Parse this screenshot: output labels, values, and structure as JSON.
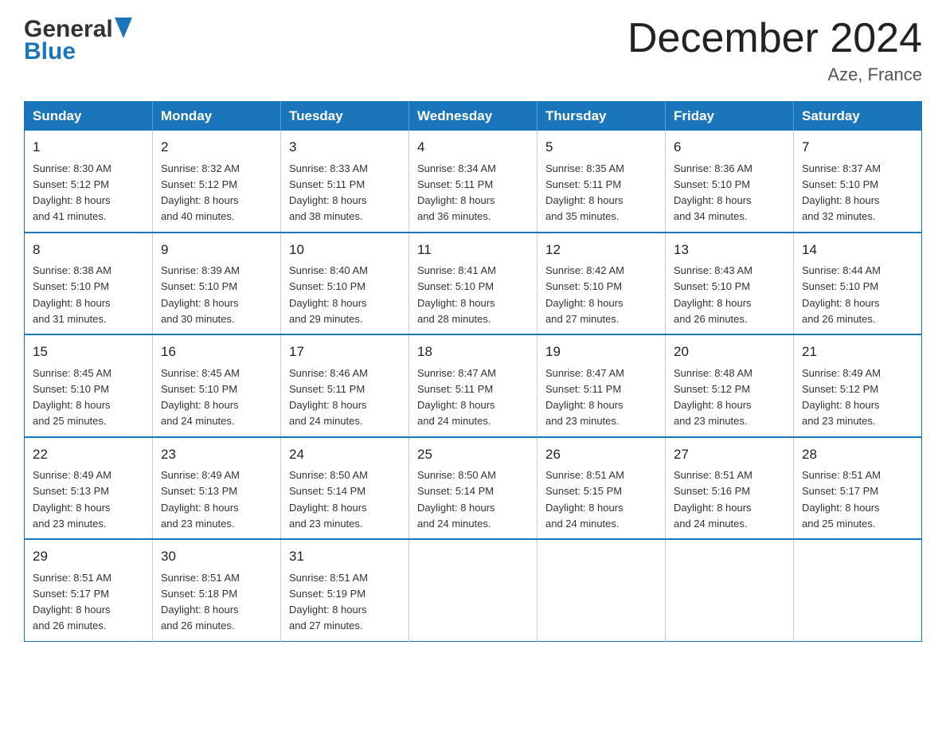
{
  "header": {
    "logo_general": "General",
    "logo_blue": "Blue",
    "title": "December 2024",
    "location": "Aze, France"
  },
  "days_of_week": [
    "Sunday",
    "Monday",
    "Tuesday",
    "Wednesday",
    "Thursday",
    "Friday",
    "Saturday"
  ],
  "weeks": [
    [
      {
        "day": "1",
        "sunrise": "Sunrise: 8:30 AM",
        "sunset": "Sunset: 5:12 PM",
        "daylight": "Daylight: 8 hours",
        "daylight2": "and 41 minutes."
      },
      {
        "day": "2",
        "sunrise": "Sunrise: 8:32 AM",
        "sunset": "Sunset: 5:12 PM",
        "daylight": "Daylight: 8 hours",
        "daylight2": "and 40 minutes."
      },
      {
        "day": "3",
        "sunrise": "Sunrise: 8:33 AM",
        "sunset": "Sunset: 5:11 PM",
        "daylight": "Daylight: 8 hours",
        "daylight2": "and 38 minutes."
      },
      {
        "day": "4",
        "sunrise": "Sunrise: 8:34 AM",
        "sunset": "Sunset: 5:11 PM",
        "daylight": "Daylight: 8 hours",
        "daylight2": "and 36 minutes."
      },
      {
        "day": "5",
        "sunrise": "Sunrise: 8:35 AM",
        "sunset": "Sunset: 5:11 PM",
        "daylight": "Daylight: 8 hours",
        "daylight2": "and 35 minutes."
      },
      {
        "day": "6",
        "sunrise": "Sunrise: 8:36 AM",
        "sunset": "Sunset: 5:10 PM",
        "daylight": "Daylight: 8 hours",
        "daylight2": "and 34 minutes."
      },
      {
        "day": "7",
        "sunrise": "Sunrise: 8:37 AM",
        "sunset": "Sunset: 5:10 PM",
        "daylight": "Daylight: 8 hours",
        "daylight2": "and 32 minutes."
      }
    ],
    [
      {
        "day": "8",
        "sunrise": "Sunrise: 8:38 AM",
        "sunset": "Sunset: 5:10 PM",
        "daylight": "Daylight: 8 hours",
        "daylight2": "and 31 minutes."
      },
      {
        "day": "9",
        "sunrise": "Sunrise: 8:39 AM",
        "sunset": "Sunset: 5:10 PM",
        "daylight": "Daylight: 8 hours",
        "daylight2": "and 30 minutes."
      },
      {
        "day": "10",
        "sunrise": "Sunrise: 8:40 AM",
        "sunset": "Sunset: 5:10 PM",
        "daylight": "Daylight: 8 hours",
        "daylight2": "and 29 minutes."
      },
      {
        "day": "11",
        "sunrise": "Sunrise: 8:41 AM",
        "sunset": "Sunset: 5:10 PM",
        "daylight": "Daylight: 8 hours",
        "daylight2": "and 28 minutes."
      },
      {
        "day": "12",
        "sunrise": "Sunrise: 8:42 AM",
        "sunset": "Sunset: 5:10 PM",
        "daylight": "Daylight: 8 hours",
        "daylight2": "and 27 minutes."
      },
      {
        "day": "13",
        "sunrise": "Sunrise: 8:43 AM",
        "sunset": "Sunset: 5:10 PM",
        "daylight": "Daylight: 8 hours",
        "daylight2": "and 26 minutes."
      },
      {
        "day": "14",
        "sunrise": "Sunrise: 8:44 AM",
        "sunset": "Sunset: 5:10 PM",
        "daylight": "Daylight: 8 hours",
        "daylight2": "and 26 minutes."
      }
    ],
    [
      {
        "day": "15",
        "sunrise": "Sunrise: 8:45 AM",
        "sunset": "Sunset: 5:10 PM",
        "daylight": "Daylight: 8 hours",
        "daylight2": "and 25 minutes."
      },
      {
        "day": "16",
        "sunrise": "Sunrise: 8:45 AM",
        "sunset": "Sunset: 5:10 PM",
        "daylight": "Daylight: 8 hours",
        "daylight2": "and 24 minutes."
      },
      {
        "day": "17",
        "sunrise": "Sunrise: 8:46 AM",
        "sunset": "Sunset: 5:11 PM",
        "daylight": "Daylight: 8 hours",
        "daylight2": "and 24 minutes."
      },
      {
        "day": "18",
        "sunrise": "Sunrise: 8:47 AM",
        "sunset": "Sunset: 5:11 PM",
        "daylight": "Daylight: 8 hours",
        "daylight2": "and 24 minutes."
      },
      {
        "day": "19",
        "sunrise": "Sunrise: 8:47 AM",
        "sunset": "Sunset: 5:11 PM",
        "daylight": "Daylight: 8 hours",
        "daylight2": "and 23 minutes."
      },
      {
        "day": "20",
        "sunrise": "Sunrise: 8:48 AM",
        "sunset": "Sunset: 5:12 PM",
        "daylight": "Daylight: 8 hours",
        "daylight2": "and 23 minutes."
      },
      {
        "day": "21",
        "sunrise": "Sunrise: 8:49 AM",
        "sunset": "Sunset: 5:12 PM",
        "daylight": "Daylight: 8 hours",
        "daylight2": "and 23 minutes."
      }
    ],
    [
      {
        "day": "22",
        "sunrise": "Sunrise: 8:49 AM",
        "sunset": "Sunset: 5:13 PM",
        "daylight": "Daylight: 8 hours",
        "daylight2": "and 23 minutes."
      },
      {
        "day": "23",
        "sunrise": "Sunrise: 8:49 AM",
        "sunset": "Sunset: 5:13 PM",
        "daylight": "Daylight: 8 hours",
        "daylight2": "and 23 minutes."
      },
      {
        "day": "24",
        "sunrise": "Sunrise: 8:50 AM",
        "sunset": "Sunset: 5:14 PM",
        "daylight": "Daylight: 8 hours",
        "daylight2": "and 23 minutes."
      },
      {
        "day": "25",
        "sunrise": "Sunrise: 8:50 AM",
        "sunset": "Sunset: 5:14 PM",
        "daylight": "Daylight: 8 hours",
        "daylight2": "and 24 minutes."
      },
      {
        "day": "26",
        "sunrise": "Sunrise: 8:51 AM",
        "sunset": "Sunset: 5:15 PM",
        "daylight": "Daylight: 8 hours",
        "daylight2": "and 24 minutes."
      },
      {
        "day": "27",
        "sunrise": "Sunrise: 8:51 AM",
        "sunset": "Sunset: 5:16 PM",
        "daylight": "Daylight: 8 hours",
        "daylight2": "and 24 minutes."
      },
      {
        "day": "28",
        "sunrise": "Sunrise: 8:51 AM",
        "sunset": "Sunset: 5:17 PM",
        "daylight": "Daylight: 8 hours",
        "daylight2": "and 25 minutes."
      }
    ],
    [
      {
        "day": "29",
        "sunrise": "Sunrise: 8:51 AM",
        "sunset": "Sunset: 5:17 PM",
        "daylight": "Daylight: 8 hours",
        "daylight2": "and 26 minutes."
      },
      {
        "day": "30",
        "sunrise": "Sunrise: 8:51 AM",
        "sunset": "Sunset: 5:18 PM",
        "daylight": "Daylight: 8 hours",
        "daylight2": "and 26 minutes."
      },
      {
        "day": "31",
        "sunrise": "Sunrise: 8:51 AM",
        "sunset": "Sunset: 5:19 PM",
        "daylight": "Daylight: 8 hours",
        "daylight2": "and 27 minutes."
      },
      null,
      null,
      null,
      null
    ]
  ]
}
